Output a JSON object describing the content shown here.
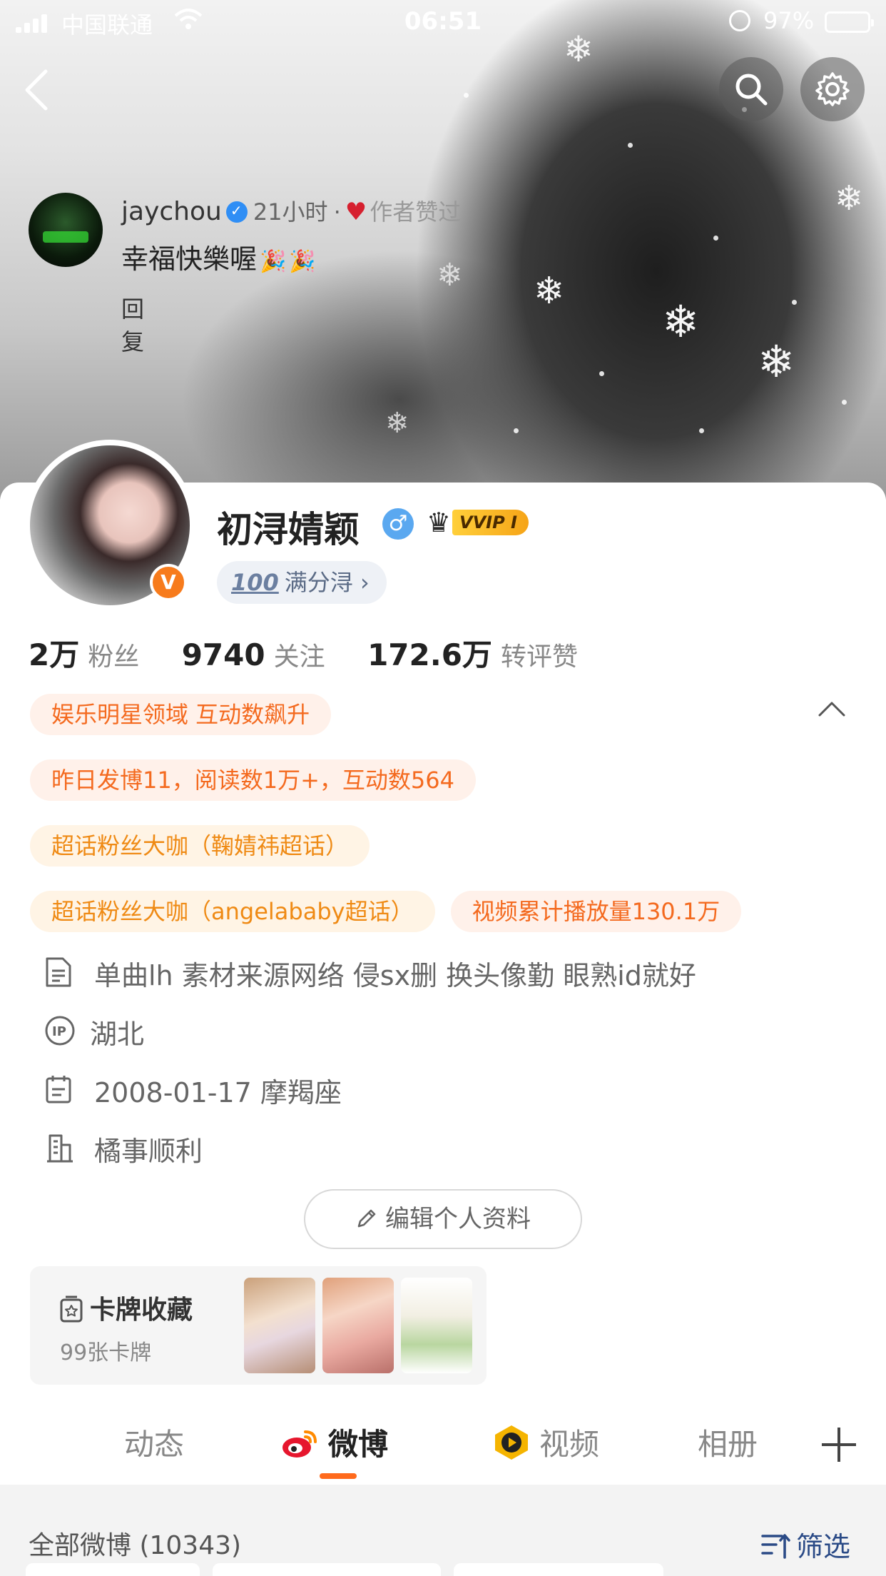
{
  "status_bar": {
    "carrier": "中国联通",
    "time": "06:51",
    "battery": "97%",
    "battery_color": "#ffd400"
  },
  "nav": {
    "back_icon": "chevron-left-icon",
    "search_icon": "search-icon",
    "settings_icon": "gear-icon"
  },
  "pinned_comment": {
    "name": "jaychou",
    "time": "21小时",
    "liked": "作者赞过",
    "text": "幸福快樂喔",
    "reply": "回复"
  },
  "profile": {
    "name": "初浔婧颖",
    "gender_icon": "male-icon",
    "vip_label": "VVIP Ⅰ",
    "badge_label": "满分浔",
    "badge_prefix": "100",
    "stats": [
      {
        "value": "2万",
        "label": "粉丝"
      },
      {
        "value": "9740",
        "label": "关注"
      },
      {
        "value": "172.6万",
        "label": "转评赞"
      }
    ],
    "tags": [
      [
        "娱乐明星领域 互动数飙升"
      ],
      [
        "昨日发博11，阅读数1万+，互动数564"
      ],
      [
        "超话粉丝大咖（鞠婧祎超话）"
      ],
      [
        "超话粉丝大咖（angelababy超话）",
        "视频累计播放量130.1万"
      ]
    ],
    "info": [
      {
        "icon": "document-icon",
        "text": "单曲lh 素材来源网络 侵sx删 换头像勤 眼熟id就好"
      },
      {
        "icon": "ip-icon",
        "text": "湖北"
      },
      {
        "icon": "calendar-icon",
        "text": "2008-01-17 摩羯座"
      },
      {
        "icon": "building-icon",
        "text": "橘事顺利"
      }
    ],
    "edit_label": "编辑个人资料",
    "cards": {
      "title": "卡牌收藏",
      "count": "99张卡牌"
    }
  },
  "tabs": [
    {
      "label": "动态"
    },
    {
      "label": "微博"
    },
    {
      "label": "视频"
    },
    {
      "label": "相册"
    }
  ],
  "feed": {
    "title": "全部微博 (10343)",
    "filter": "筛选"
  },
  "colors": {
    "accent_orange": "#ff6a1c",
    "tag_orange": "#f46a1f",
    "link_blue": "#2a4a86"
  }
}
